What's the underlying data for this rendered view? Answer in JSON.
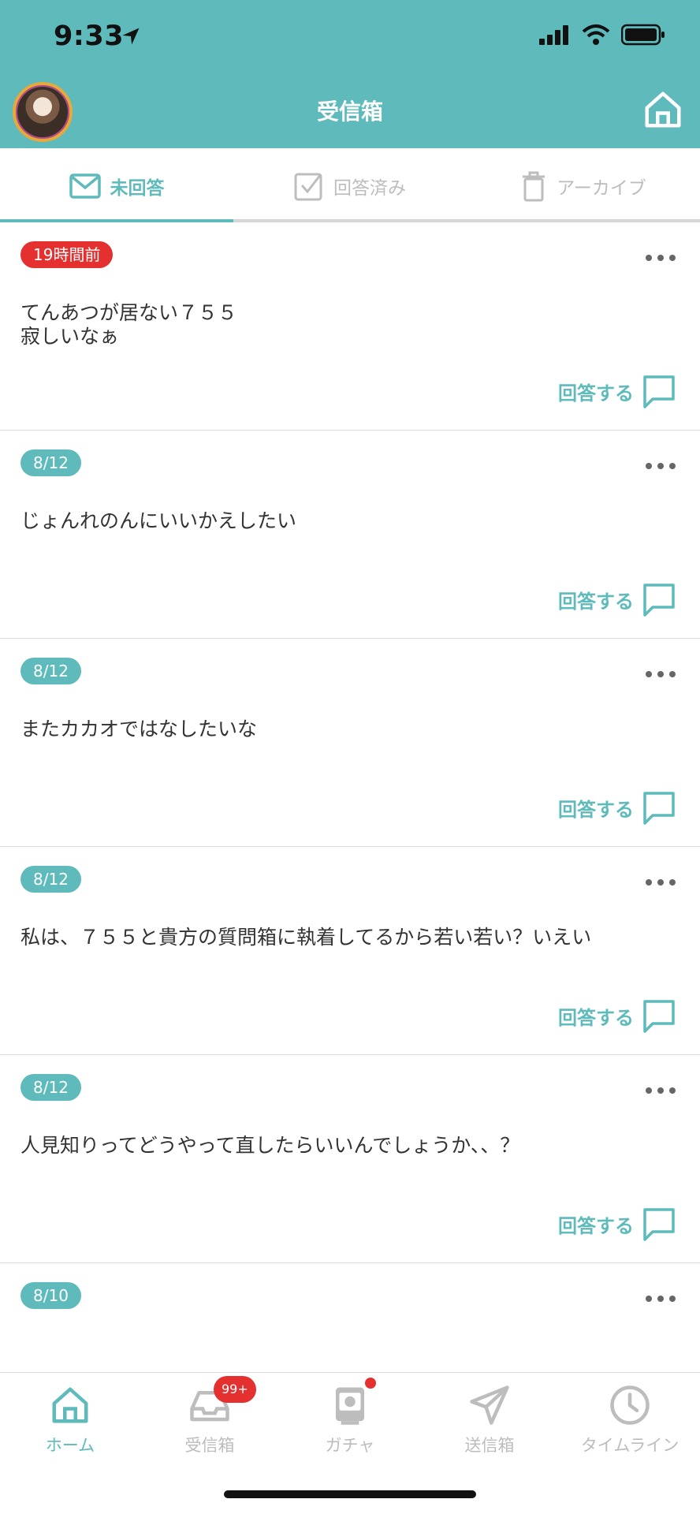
{
  "status_bar": {
    "time": "9:33"
  },
  "header": {
    "title": "受信箱"
  },
  "tabs": [
    {
      "label": "未回答",
      "icon": "mail-icon",
      "active": true
    },
    {
      "label": "回答済み",
      "icon": "checkbox-icon",
      "active": false
    },
    {
      "label": "アーカイブ",
      "icon": "trash-icon",
      "active": false
    }
  ],
  "questions": [
    {
      "date": "19時間前",
      "recent": true,
      "text": "てんあつが居ない７５５\n寂しいなぁ",
      "answer_label": "回答する"
    },
    {
      "date": "8/12",
      "recent": false,
      "text": "じょんれのんにいいかえしたい",
      "answer_label": "回答する"
    },
    {
      "date": "8/12",
      "recent": false,
      "text": "またカカオではなしたいな",
      "answer_label": "回答する"
    },
    {
      "date": "8/12",
      "recent": false,
      "text": "私は、７５５と貴方の質問箱に執着してるから若い若い？いえい",
      "answer_label": "回答する"
    },
    {
      "date": "8/12",
      "recent": false,
      "text": "人見知りってどうやって直したらいいんでしょうか、、？",
      "answer_label": "回答する"
    },
    {
      "date": "8/10",
      "recent": false,
      "text": "",
      "answer_label": ""
    }
  ],
  "bottom_nav": [
    {
      "label": "ホーム",
      "icon": "home-icon",
      "active": true
    },
    {
      "label": "受信箱",
      "icon": "inbox-icon",
      "active": false,
      "badge": "99+"
    },
    {
      "label": "ガチャ",
      "icon": "gacha-icon",
      "active": false,
      "dot": true
    },
    {
      "label": "送信箱",
      "icon": "send-icon",
      "active": false
    },
    {
      "label": "タイムライン",
      "icon": "clock-icon",
      "active": false
    }
  ],
  "colors": {
    "primary": "#5ebabb",
    "alert": "#e53030",
    "inactive": "#bdbdbd"
  }
}
